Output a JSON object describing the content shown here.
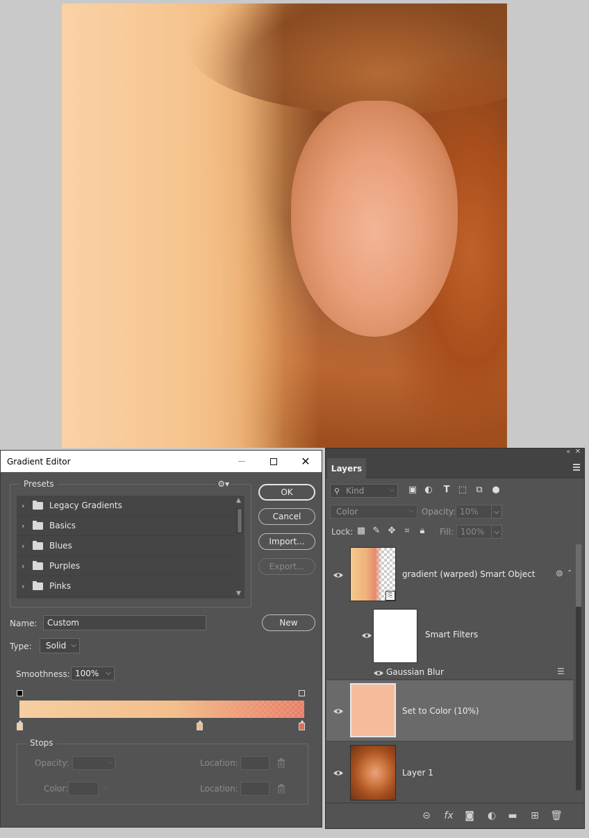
{
  "gradient_editor": {
    "title": "Gradient Editor",
    "presets_label": "Presets",
    "presets": [
      {
        "label": "Legacy Gradients"
      },
      {
        "label": "Basics"
      },
      {
        "label": "Blues"
      },
      {
        "label": "Purples"
      },
      {
        "label": "Pinks"
      }
    ],
    "buttons": {
      "ok": "OK",
      "cancel": "Cancel",
      "import": "Import...",
      "export": "Export...",
      "new": "New"
    },
    "name_label": "Name:",
    "name_value": "Custom",
    "type_label": "Type:",
    "type_value": "Solid",
    "smoothness_label": "Smoothness:",
    "smoothness_value": "100%",
    "stops_label": "Stops",
    "stops_opacity_label": "Opacity:",
    "stops_color_label": "Color:",
    "stops_location_label_1": "Location:",
    "stops_location_label_2": "Location:",
    "color_stops": [
      "#f6cea0",
      "#f3bb84",
      "#e07050"
    ],
    "bar_colors": {
      "start": "#f6cea0",
      "mid": "#f3be8c",
      "end": "#e87c64"
    }
  },
  "layers_panel": {
    "tab": "Layers",
    "kind_placeholder": "Kind",
    "blend_mode": "Color",
    "opacity_label": "Opacity:",
    "opacity_value": "10%",
    "lock_label": "Lock:",
    "fill_label": "Fill:",
    "fill_value": "100%",
    "layers": [
      {
        "name": "gradient (warped) Smart Object"
      },
      {
        "name": "Smart Filters"
      },
      {
        "name": "Gaussian Blur"
      },
      {
        "name": "Set to Color (10%)",
        "selected": true
      },
      {
        "name": "Layer 1"
      }
    ],
    "set_to_color_swatch": "#f4bc9b"
  }
}
